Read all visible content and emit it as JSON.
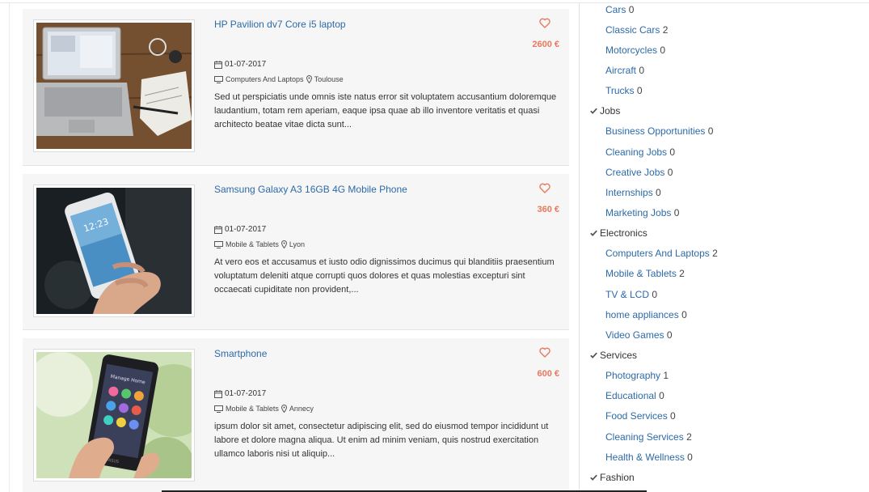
{
  "listings": [
    {
      "title": "HP Pavilion dv7 Core i5 laptop",
      "price": "2600 €",
      "date": "01-07-2017",
      "category": "Computers And Laptops",
      "location": "Toulouse",
      "description": "Sed ut perspiciatis unde omnis iste natus error sit voluptatem accusantium doloremque laudantium, totam rem aperiam, eaque ipsa quae ab illo inventore veritatis et quasi architecto beatae vitae dicta sunt..."
    },
    {
      "title": "Samsung Galaxy A3 16GB 4G Mobile Phone",
      "price": "360 €",
      "date": "01-07-2017",
      "category": "Mobile & Tablets",
      "location": "Lyon",
      "description": "At vero eos et accusamus et iusto odio dignissimos ducimus qui blanditiis praesentium voluptatum deleniti atque corrupti quos dolores et quas molestias excepturi sint occaecati cupiditate non provident,..."
    },
    {
      "title": "Smartphone",
      "price": "600 €",
      "date": "01-07-2017",
      "category": "Mobile & Tablets",
      "location": "Annecy",
      "description": "ipsum dolor sit amet, consectetur adipiscing elit, sed do eiusmod tempor incididunt ut labore et dolore magna aliqua. Ut enim ad minim veniam, quis nostrud exercitation ullamco laboris nisi ut aliquip..."
    }
  ],
  "phone_screen": {
    "time": "12:23",
    "menu_title": "Manage Home",
    "brand": "ASUS"
  },
  "sidebar": {
    "vehicles": [
      {
        "label": "Cars",
        "count": "0"
      },
      {
        "label": "Classic Cars",
        "count": "2"
      },
      {
        "label": "Motorcycles",
        "count": "0"
      },
      {
        "label": "Aircraft",
        "count": "0"
      },
      {
        "label": "Trucks",
        "count": "0"
      }
    ],
    "jobs_label": "Jobs",
    "jobs": [
      {
        "label": "Business Opportunities",
        "count": "0"
      },
      {
        "label": "Cleaning Jobs",
        "count": "0"
      },
      {
        "label": "Creative Jobs",
        "count": "0"
      },
      {
        "label": "Internships",
        "count": "0"
      },
      {
        "label": "Marketing Jobs",
        "count": "0"
      }
    ],
    "electronics_label": "Electronics",
    "electronics": [
      {
        "label": "Computers And Laptops",
        "count": "2"
      },
      {
        "label": "Mobile & Tablets",
        "count": "2"
      },
      {
        "label": "TV & LCD",
        "count": "0"
      },
      {
        "label": "home appliances",
        "count": "0"
      },
      {
        "label": "Video Games",
        "count": "0"
      }
    ],
    "services_label": "Services",
    "services": [
      {
        "label": "Photography",
        "count": "1"
      },
      {
        "label": "Educational",
        "count": "0"
      },
      {
        "label": "Food Services",
        "count": "0"
      },
      {
        "label": "Cleaning Services",
        "count": "2"
      },
      {
        "label": "Health & Wellness",
        "count": "0"
      }
    ],
    "fashion_label": "Fashion"
  },
  "colors": {
    "link": "#2c6aa8",
    "price": "#e8795e",
    "card_bg": "#f6f6f6"
  },
  "icons": [
    "heart-icon",
    "calendar-icon",
    "monitor-icon",
    "map-pin-icon",
    "checkmark-icon"
  ]
}
